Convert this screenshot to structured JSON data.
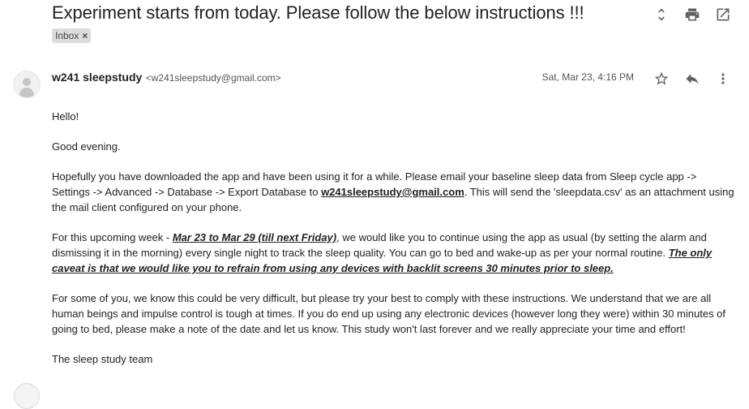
{
  "subject": "Experiment starts from today. Please follow the below instructions !!!",
  "label": {
    "text": "Inbox",
    "remove_symbol": "×"
  },
  "toolbar": {
    "icons": [
      "expand-collapse-icon",
      "print-icon",
      "open-in-new-window-icon"
    ]
  },
  "message": {
    "sender_name": "w241 sleepstudy",
    "sender_email": "<w241sleepstudy@gmail.com>",
    "date": "Sat, Mar 23, 4:16 PM",
    "actions": [
      "star-icon",
      "reply-icon",
      "more-options-icon"
    ]
  },
  "body": {
    "greeting": "Hello!",
    "evening": "Good evening.",
    "p1": {
      "before": "Hopefully you have downloaded the app and have been using it for a while. Please email your baseline sleep data from Sleep cycle app -> Settings -> Advanced -> Database  -> Export Database to ",
      "link": "w241sleepstudy@gmail.com",
      "after": ". This will send the 'sleepdata.csv' as an attachment using the mail client configured on your phone."
    },
    "p2": {
      "before": " For this upcoming week - ",
      "dates": "Mar 23 to Mar 29 (till next Friday)",
      "middle": ", we would like you to continue using the app as usual (by setting the alarm and dismissing it in the morning) every single night to track the sleep quality.  You can go to bed and wake-up as per your normal routine. ",
      "caveat": "The only caveat is that we would like you to refrain from using any devices with backlit screens 30 minutes prior to sleep."
    },
    "p3": " For some of you, we know this could be very difficult, but please try your best to comply with these instructions.  We understand that we are all human beings and impulse control is tough at times.  If you do end up using any electronic devices (however long they were) within 30 minutes of going to bed, please make a note of the date and let us know.  This study won't last forever and we really appreciate your time and effort!",
    "signature": "The sleep study team"
  }
}
